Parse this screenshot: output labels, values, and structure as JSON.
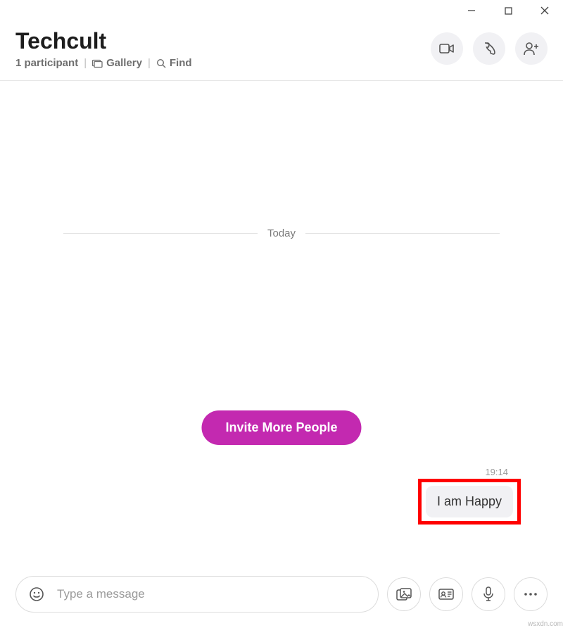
{
  "window": {
    "watermark": "wsxdn.com"
  },
  "header": {
    "title": "Techcult",
    "participants": "1 participant",
    "gallery": "Gallery",
    "find": "Find"
  },
  "chat": {
    "date_divider": "Today",
    "invite_label": "Invite More People",
    "message_time": "19:14",
    "message_text": "I am Happy"
  },
  "composer": {
    "placeholder": "Type a message"
  }
}
